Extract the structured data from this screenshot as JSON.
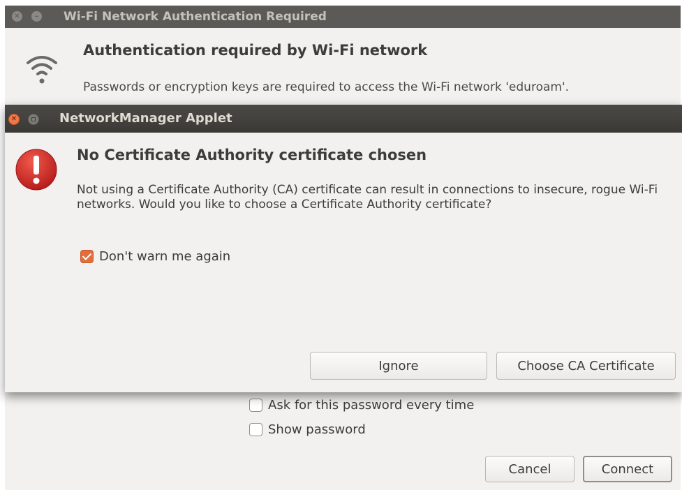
{
  "background_dialog": {
    "title": "Wi-Fi Network Authentication Required",
    "icon": "wifi-icon",
    "heading": "Authentication required by Wi-Fi network",
    "description": "Passwords or encryption keys are required to access the Wi-Fi network 'eduroam'.",
    "ask_password_label": "Ask for this password every time",
    "ask_password_checked": false,
    "show_password_label": "Show password",
    "show_password_checked": false,
    "cancel_label": "Cancel",
    "connect_label": "Connect"
  },
  "modal": {
    "title": "NetworkManager Applet",
    "icon": "warning-icon",
    "heading": "No Certificate Authority certificate chosen",
    "message": "Not using a Certificate Authority (CA) certificate can result in connections to insecure, rogue Wi-Fi networks.  Would you like to choose a Certificate Authority certificate?",
    "dont_warn_label": "Don't warn me again",
    "dont_warn_checked": true,
    "ignore_label": "Ignore",
    "choose_label": "Choose CA Certificate"
  },
  "colors": {
    "accent": "#e36e3b",
    "titlebar_dark": "#3a3935",
    "dialog_bg": "#f2f1f0",
    "warning_red": "#d12a2a"
  }
}
